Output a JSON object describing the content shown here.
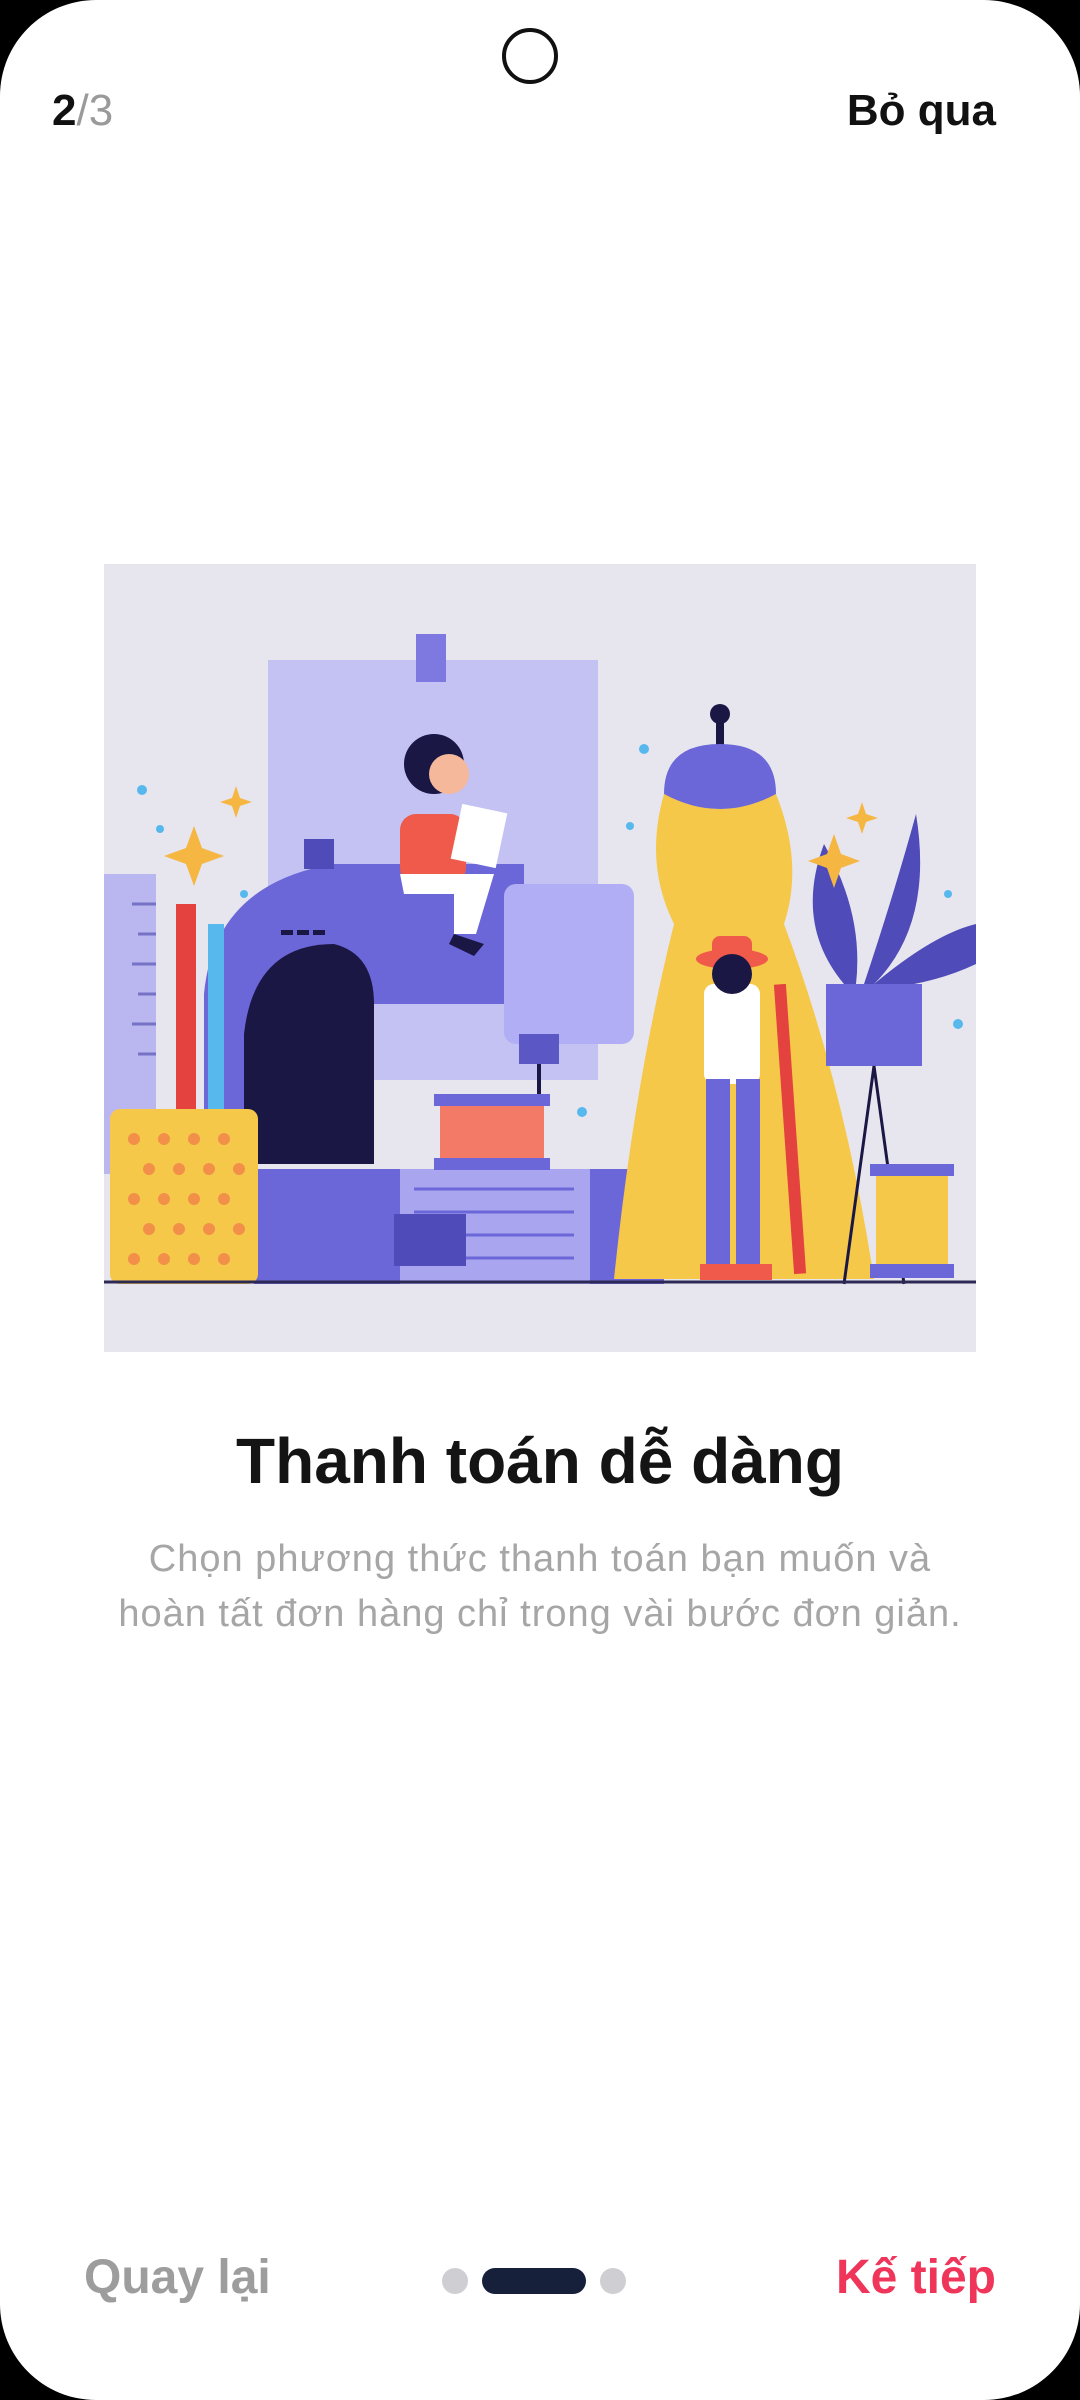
{
  "header": {
    "step_current": "2",
    "step_total": "/3",
    "skip_label": "Bỏ qua"
  },
  "content": {
    "title": "Thanh toán dễ dàng",
    "description": "Chọn phương thức thanh toán bạn muốn và hoàn tất đơn hàng chỉ trong vài bước đơn giản."
  },
  "footer": {
    "back_label": "Quay lại",
    "next_label": "Kế tiếp",
    "pager_active_index": 1,
    "pager_count": 3
  },
  "colors": {
    "accent": "#f0355b",
    "pager_active": "#16203b",
    "pager_inactive": "#cfcfd3"
  }
}
